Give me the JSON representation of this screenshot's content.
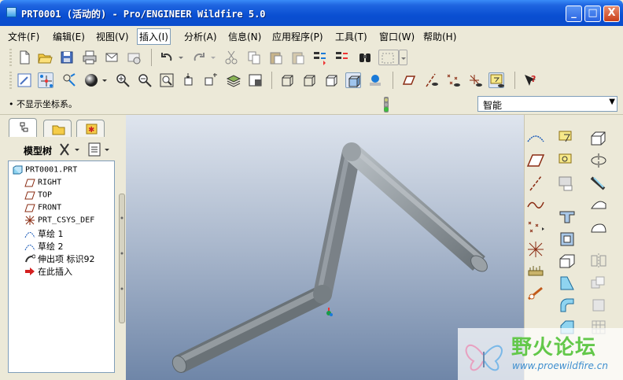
{
  "window": {
    "title": "PRT0001 (活动的) - Pro/ENGINEER Wildfire 5.0",
    "controls": [
      "_",
      "□",
      "X"
    ]
  },
  "menu": [
    {
      "label": "文件(F)"
    },
    {
      "label": "编辑(E)"
    },
    {
      "label": "视图(V)"
    },
    {
      "label": "插入(I)",
      "active": true
    },
    {
      "label": "分析(A)"
    },
    {
      "label": "信息(N)"
    },
    {
      "label": "应用程序(P)"
    },
    {
      "label": "工具(T)"
    },
    {
      "label": "窗口(W)"
    },
    {
      "label": "帮助(H)"
    }
  ],
  "status": {
    "message": "• 不显示坐标系。",
    "filter_value": "智能"
  },
  "model_tree": {
    "title": "模型树",
    "items": [
      {
        "label": "PRT0001.PRT",
        "icon": "part-icon"
      },
      {
        "label": "RIGHT",
        "icon": "datum-plane-icon"
      },
      {
        "label": "TOP",
        "icon": "datum-plane-icon"
      },
      {
        "label": "FRONT",
        "icon": "datum-plane-icon"
      },
      {
        "label": "PRT_CSYS_DEF",
        "icon": "csys-icon"
      },
      {
        "label": "草绘 1",
        "icon": "sketch-icon"
      },
      {
        "label": "草绘 2",
        "icon": "sketch-icon"
      },
      {
        "label": "伸出项 标识92",
        "icon": "sweep-icon"
      },
      {
        "label": "在此插入",
        "icon": "insert-arrow-icon"
      }
    ]
  },
  "watermark": {
    "title": "野火论坛",
    "url": "www.proewildfire.cn"
  },
  "colors": {
    "title_bar": "#0a4fd2",
    "viewport_top": "#dfe5ee",
    "viewport_bottom": "#6f86a8",
    "pipe": "#8e969c",
    "watermark_green": "#63c84a"
  }
}
